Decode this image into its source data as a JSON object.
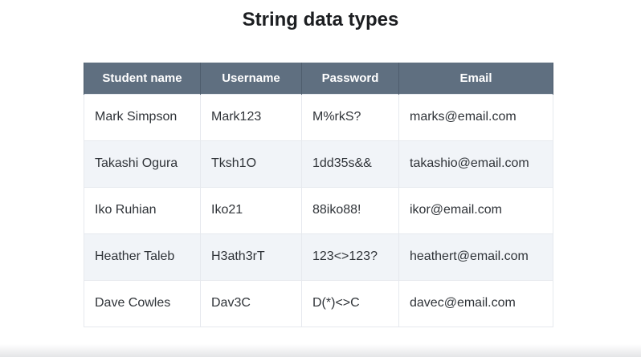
{
  "title": "String data types",
  "table": {
    "headers": [
      "Student name",
      "Username",
      "Password",
      "Email"
    ],
    "rows": [
      [
        "Mark Simpson",
        "Mark123",
        "M%rkS?",
        "marks@email.com"
      ],
      [
        "Takashi Ogura",
        "Tksh1O",
        "1dd35s&&",
        "takashio@email.com"
      ],
      [
        "Iko Ruhian",
        "Iko21",
        "88iko88!",
        "ikor@email.com"
      ],
      [
        "Heather Taleb",
        "H3ath3rT",
        "123<>123?",
        "heathert@email.com"
      ],
      [
        "Dave Cowles",
        "Dav3C",
        "D(*)<>C",
        "davec@email.com"
      ]
    ]
  },
  "colors": {
    "header_background": "#5f6f80",
    "header_text": "#ffffff",
    "alt_row_background": "#f1f4f8",
    "body_text": "#2f3338"
  }
}
